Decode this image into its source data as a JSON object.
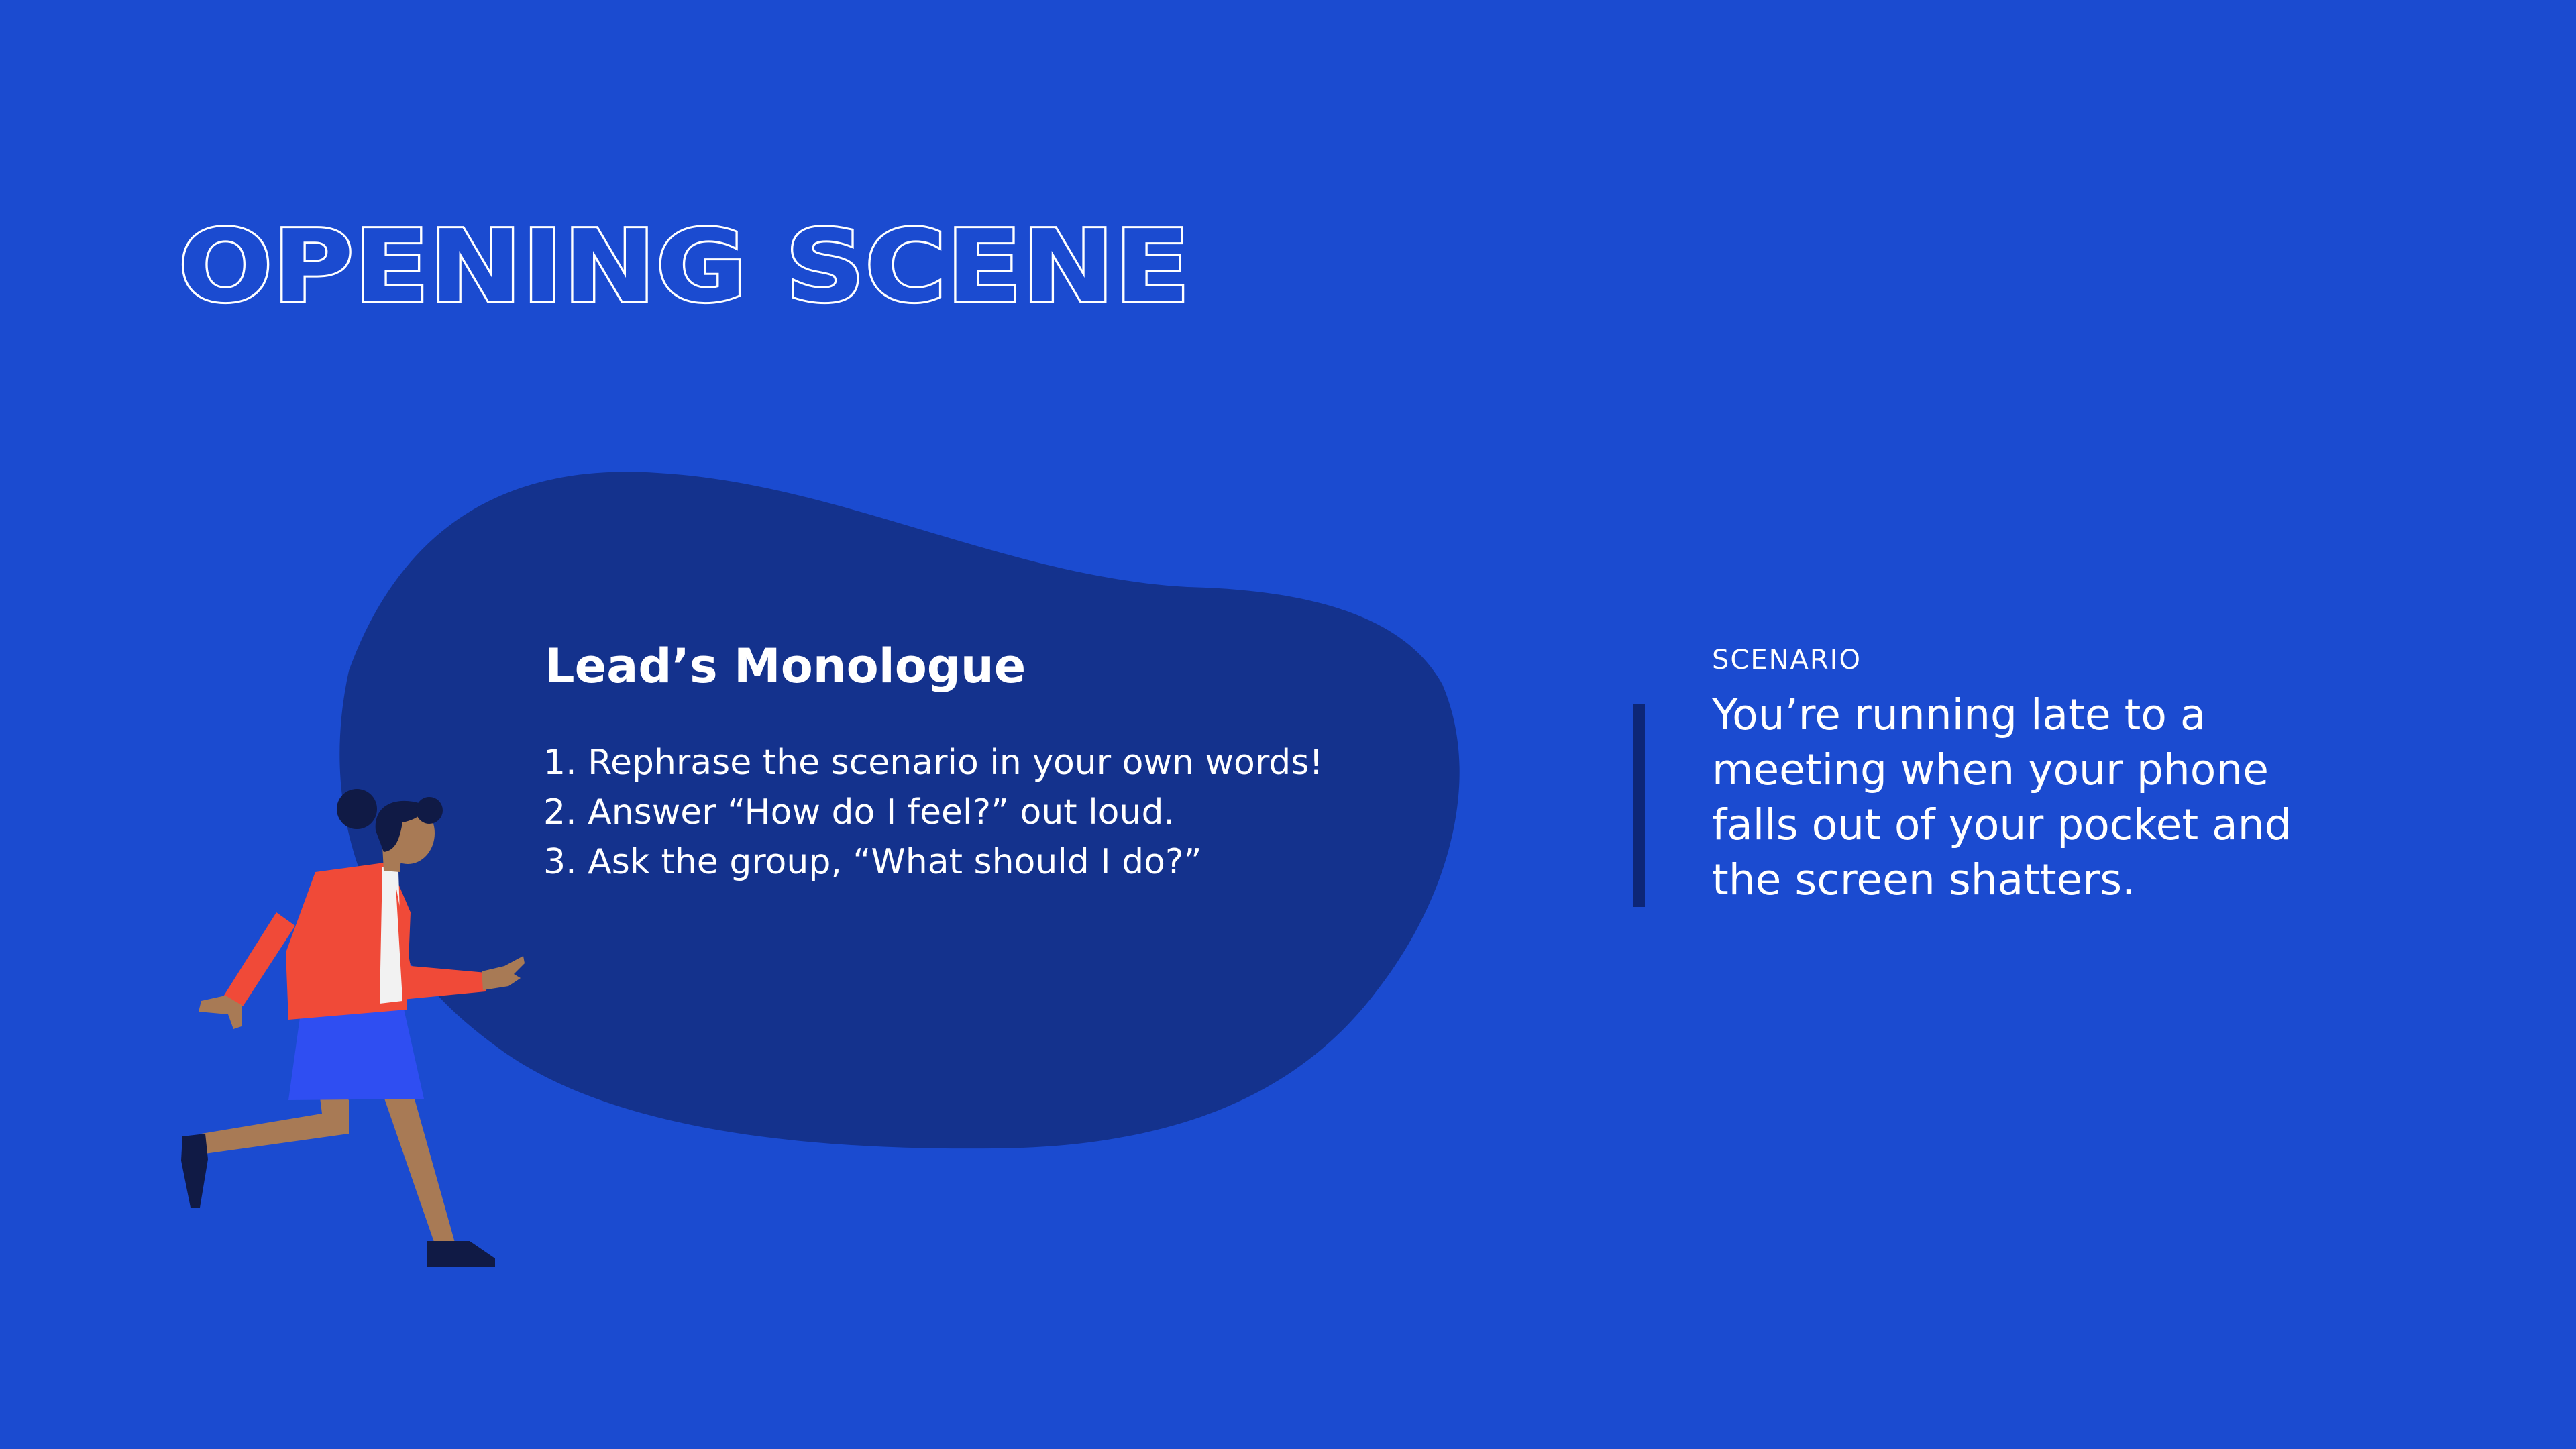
{
  "slide": {
    "title": "OPENING SCENE"
  },
  "monologue": {
    "heading": "Lead’s Monologue",
    "steps": [
      "1. Rephrase the scenario in your own words!",
      "2. Answer “How do I feel?” out loud.",
      "3. Ask the group, “What should I do?”"
    ]
  },
  "scenario": {
    "label": "SCENARIO",
    "lines": [
      "You’re running late to a",
      "meeting when your phone",
      "falls out of your pocket and",
      "the screen shatters."
    ]
  },
  "colors": {
    "background": "#1b4bd0",
    "blob": "#14328d",
    "divider": "#0d2677",
    "text": "#ffffff",
    "jacket": "#f04a38",
    "skirt": "#2f4ef2",
    "skin": "#a87a55",
    "hair": "#101a45"
  },
  "illustration": {
    "name": "running-woman-illustration"
  }
}
